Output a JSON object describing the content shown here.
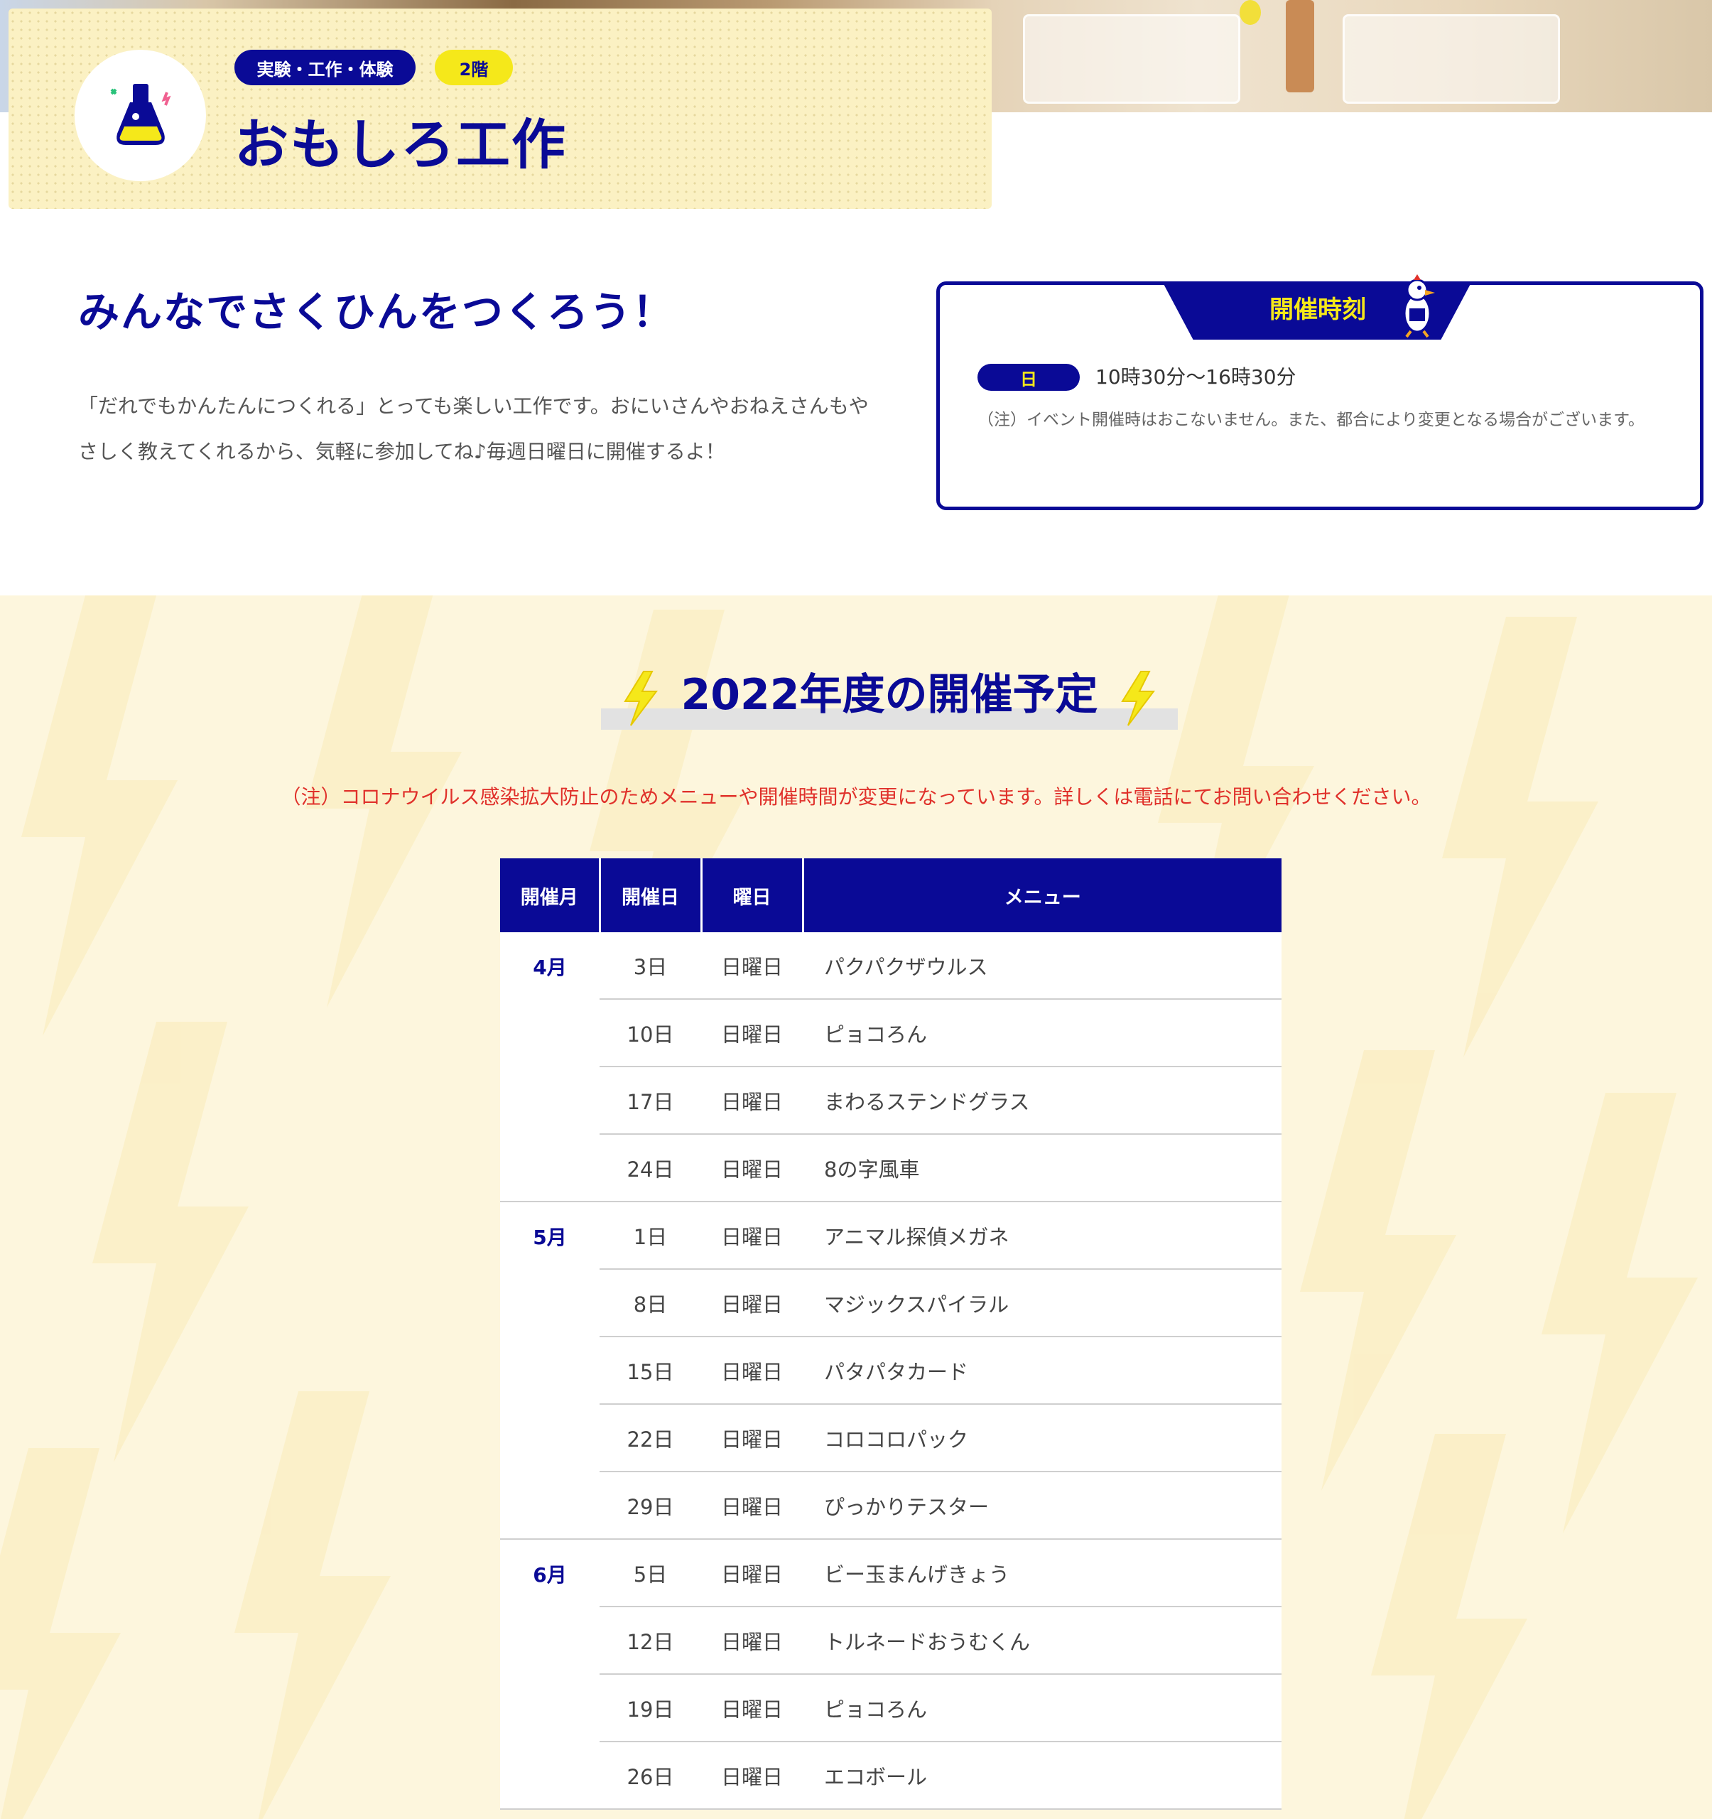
{
  "header": {
    "category_badge": "実験・工作・体験",
    "floor_badge": "2階",
    "title": "おもしろ工作",
    "icon": "flask-icon"
  },
  "intro": {
    "heading": "みんなでさくひんをつくろう！",
    "text": "「だれでもかんたんにつくれる」とっても楽しい工作です。おにいさんやおねえさんもやさしく教えてくれるから、気軽に参加してね♪毎週日曜日に開催するよ！"
  },
  "schedule_box": {
    "title": "開催時刻",
    "day_label": "日",
    "time": "10時30分～16時30分",
    "note": "（注）イベント開催時はおこないません。また、都合により変更となる場合がございます。",
    "mascot_icon": "mascot-icon"
  },
  "annual": {
    "heading": "2022年度の開催予定",
    "covid_note": "（注）コロナウイルス感染拡大防止のためメニューや開催時間が変更になっています。詳しくは電話にてお問い合わせください。",
    "headers": {
      "month": "開催月",
      "day": "開催日",
      "weekday": "曜日",
      "menu": "メニュー"
    },
    "months": [
      {
        "month": "4月",
        "rows": [
          {
            "day": "3日",
            "weekday": "日曜日",
            "menu": "パクパクザウルス"
          },
          {
            "day": "10日",
            "weekday": "日曜日",
            "menu": "ピョコろん"
          },
          {
            "day": "17日",
            "weekday": "日曜日",
            "menu": "まわるステンドグラス"
          },
          {
            "day": "24日",
            "weekday": "日曜日",
            "menu": "8の字風車"
          }
        ]
      },
      {
        "month": "5月",
        "rows": [
          {
            "day": "1日",
            "weekday": "日曜日",
            "menu": "アニマル探偵メガネ"
          },
          {
            "day": "8日",
            "weekday": "日曜日",
            "menu": "マジックスパイラル"
          },
          {
            "day": "15日",
            "weekday": "日曜日",
            "menu": "パタパタカード"
          },
          {
            "day": "22日",
            "weekday": "日曜日",
            "menu": "コロコロパック"
          },
          {
            "day": "29日",
            "weekday": "日曜日",
            "menu": "ぴっかりテスター"
          }
        ]
      },
      {
        "month": "6月",
        "rows": [
          {
            "day": "5日",
            "weekday": "日曜日",
            "menu": "ビー玉まんげきょう"
          },
          {
            "day": "12日",
            "weekday": "日曜日",
            "menu": "トルネードおうむくん"
          },
          {
            "day": "19日",
            "weekday": "日曜日",
            "menu": "ピョコろん"
          },
          {
            "day": "26日",
            "weekday": "日曜日",
            "menu": "エコボール"
          }
        ]
      }
    ]
  },
  "colors": {
    "navy": "#0a0a96",
    "yellow": "#f5e81a",
    "cream": "#fdf6dd",
    "alert_red": "#e0312b"
  }
}
